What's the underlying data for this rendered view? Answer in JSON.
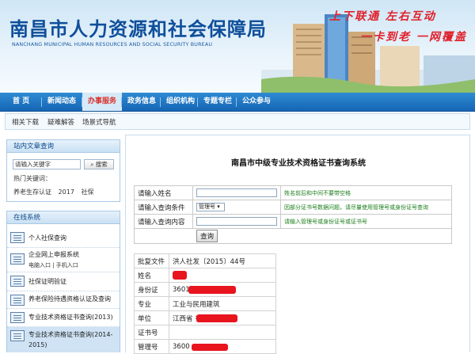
{
  "header": {
    "title": "南昌市人力资源和社会保障局",
    "subtitle": "NANCHANG MUNICIPAL HUMAN RESOURCES AND SOCIAL SECURITY BUREAU",
    "slogan_line1": "上下联通 左右互动",
    "slogan_line2": "一卡到老 一网覆盖"
  },
  "nav": [
    "首 页",
    "新闻动态",
    "办事服务",
    "政务信息",
    "组织机构",
    "专题专栏",
    "公众参与"
  ],
  "subnav": [
    "相关下载",
    "疑难解答",
    "场景式导航"
  ],
  "search": {
    "title": "站内文章查询",
    "placeholder": "请输入关键字",
    "button": "搜索",
    "hot_label": "热门关键词：",
    "hot_words": [
      "养老生存认证",
      "2017",
      "社保"
    ]
  },
  "services": {
    "title": "在线系统",
    "items": [
      {
        "label": "个人社保查询"
      },
      {
        "label": "企业网上申报系统",
        "sub": "电脑入口  |  手机入口"
      },
      {
        "label": "社保证明验证"
      },
      {
        "label": "养老保险待遇资格认证及查询"
      },
      {
        "label": "专业技术资格证书查询(2013)"
      },
      {
        "label": "专业技术资格证书查询(2014-",
        "label2": "2015)"
      }
    ]
  },
  "main": {
    "title": "南昌市中级专业技术资格证书查询系统",
    "form": [
      {
        "label": "请输入姓名",
        "hint": "姓名前后和中间不要带空格"
      },
      {
        "label": "请输入查询条件",
        "select": "管理号",
        "hint": "因部分证书号数据问题，请尽量使用管理号或身份证号查询"
      },
      {
        "label": "请输入查询内容",
        "hint": "请输入管理号或身份证号或证书号"
      }
    ],
    "query_button": "查询",
    "result": [
      {
        "key": "批复文件",
        "value": "洪人社发〔2015〕44号"
      },
      {
        "key": "姓名",
        "value": ""
      },
      {
        "key": "身份证",
        "value": "3601   091536"
      },
      {
        "key": "专业",
        "value": "工业与民用建筑"
      },
      {
        "key": "单位",
        "value": "江西省      有限公司"
      },
      {
        "key": "证书号",
        "value": ""
      },
      {
        "key": "管理号",
        "value": "3600"
      }
    ]
  },
  "colors": {
    "brand_blue": "#0f4f9b",
    "nav_blue": "#1f74c4",
    "accent_red": "#e1202a",
    "hint_green": "#1a7d1a"
  }
}
